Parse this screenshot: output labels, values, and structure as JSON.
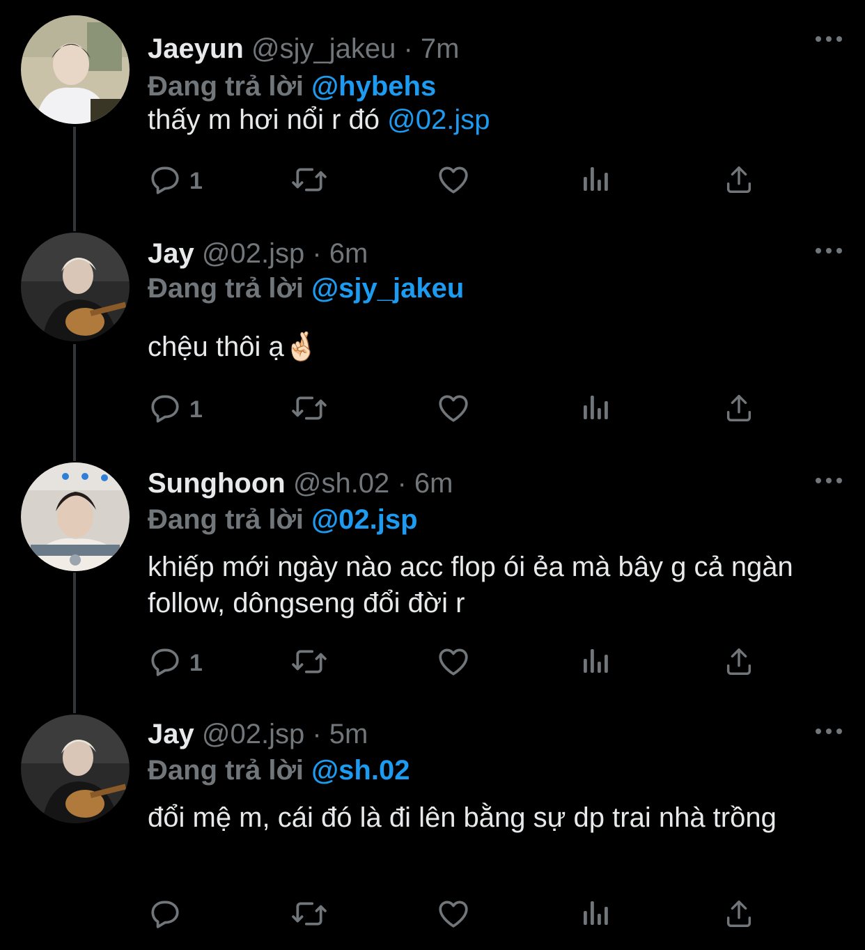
{
  "colors": {
    "background": "#000000",
    "text_primary": "#e7e9ea",
    "text_secondary": "#71767b",
    "accent": "#1d9bf0",
    "thread_line": "#333639"
  },
  "replying_label": "Đang trả lời",
  "action_icons": [
    "reply-icon",
    "retweet-icon",
    "like-icon",
    "views-icon",
    "share-icon"
  ],
  "tweets": [
    {
      "name": "Jaeyun",
      "handle": "@sjy_jakeu",
      "time": "· 7m",
      "replying_to": "@hybehs",
      "text_plain": "thấy m hơi nổi r đó ",
      "text_mention": "@02.jsp",
      "reply_count": "1"
    },
    {
      "name": "Jay",
      "handle": "@02.jsp",
      "time": "· 6m",
      "replying_to": "@sjy_jakeu",
      "text_plain": "chệu thôi ạ🤞🏻",
      "text_mention": "",
      "reply_count": "1"
    },
    {
      "name": "Sunghoon",
      "handle": "@sh.02",
      "time": "· 6m",
      "replying_to": "@02.jsp",
      "text_plain": "khiếp mới ngày nào acc flop ói ẻa mà bây g cả ngàn follow, dôngseng đổi đời r",
      "text_mention": "",
      "reply_count": "1"
    },
    {
      "name": "Jay",
      "handle": "@02.jsp",
      "time": "· 5m",
      "replying_to": "@sh.02",
      "text_plain": "đổi mệ m, cái đó là đi lên bằng sự dp trai nhà trồng",
      "text_mention": "",
      "reply_count": ""
    }
  ]
}
